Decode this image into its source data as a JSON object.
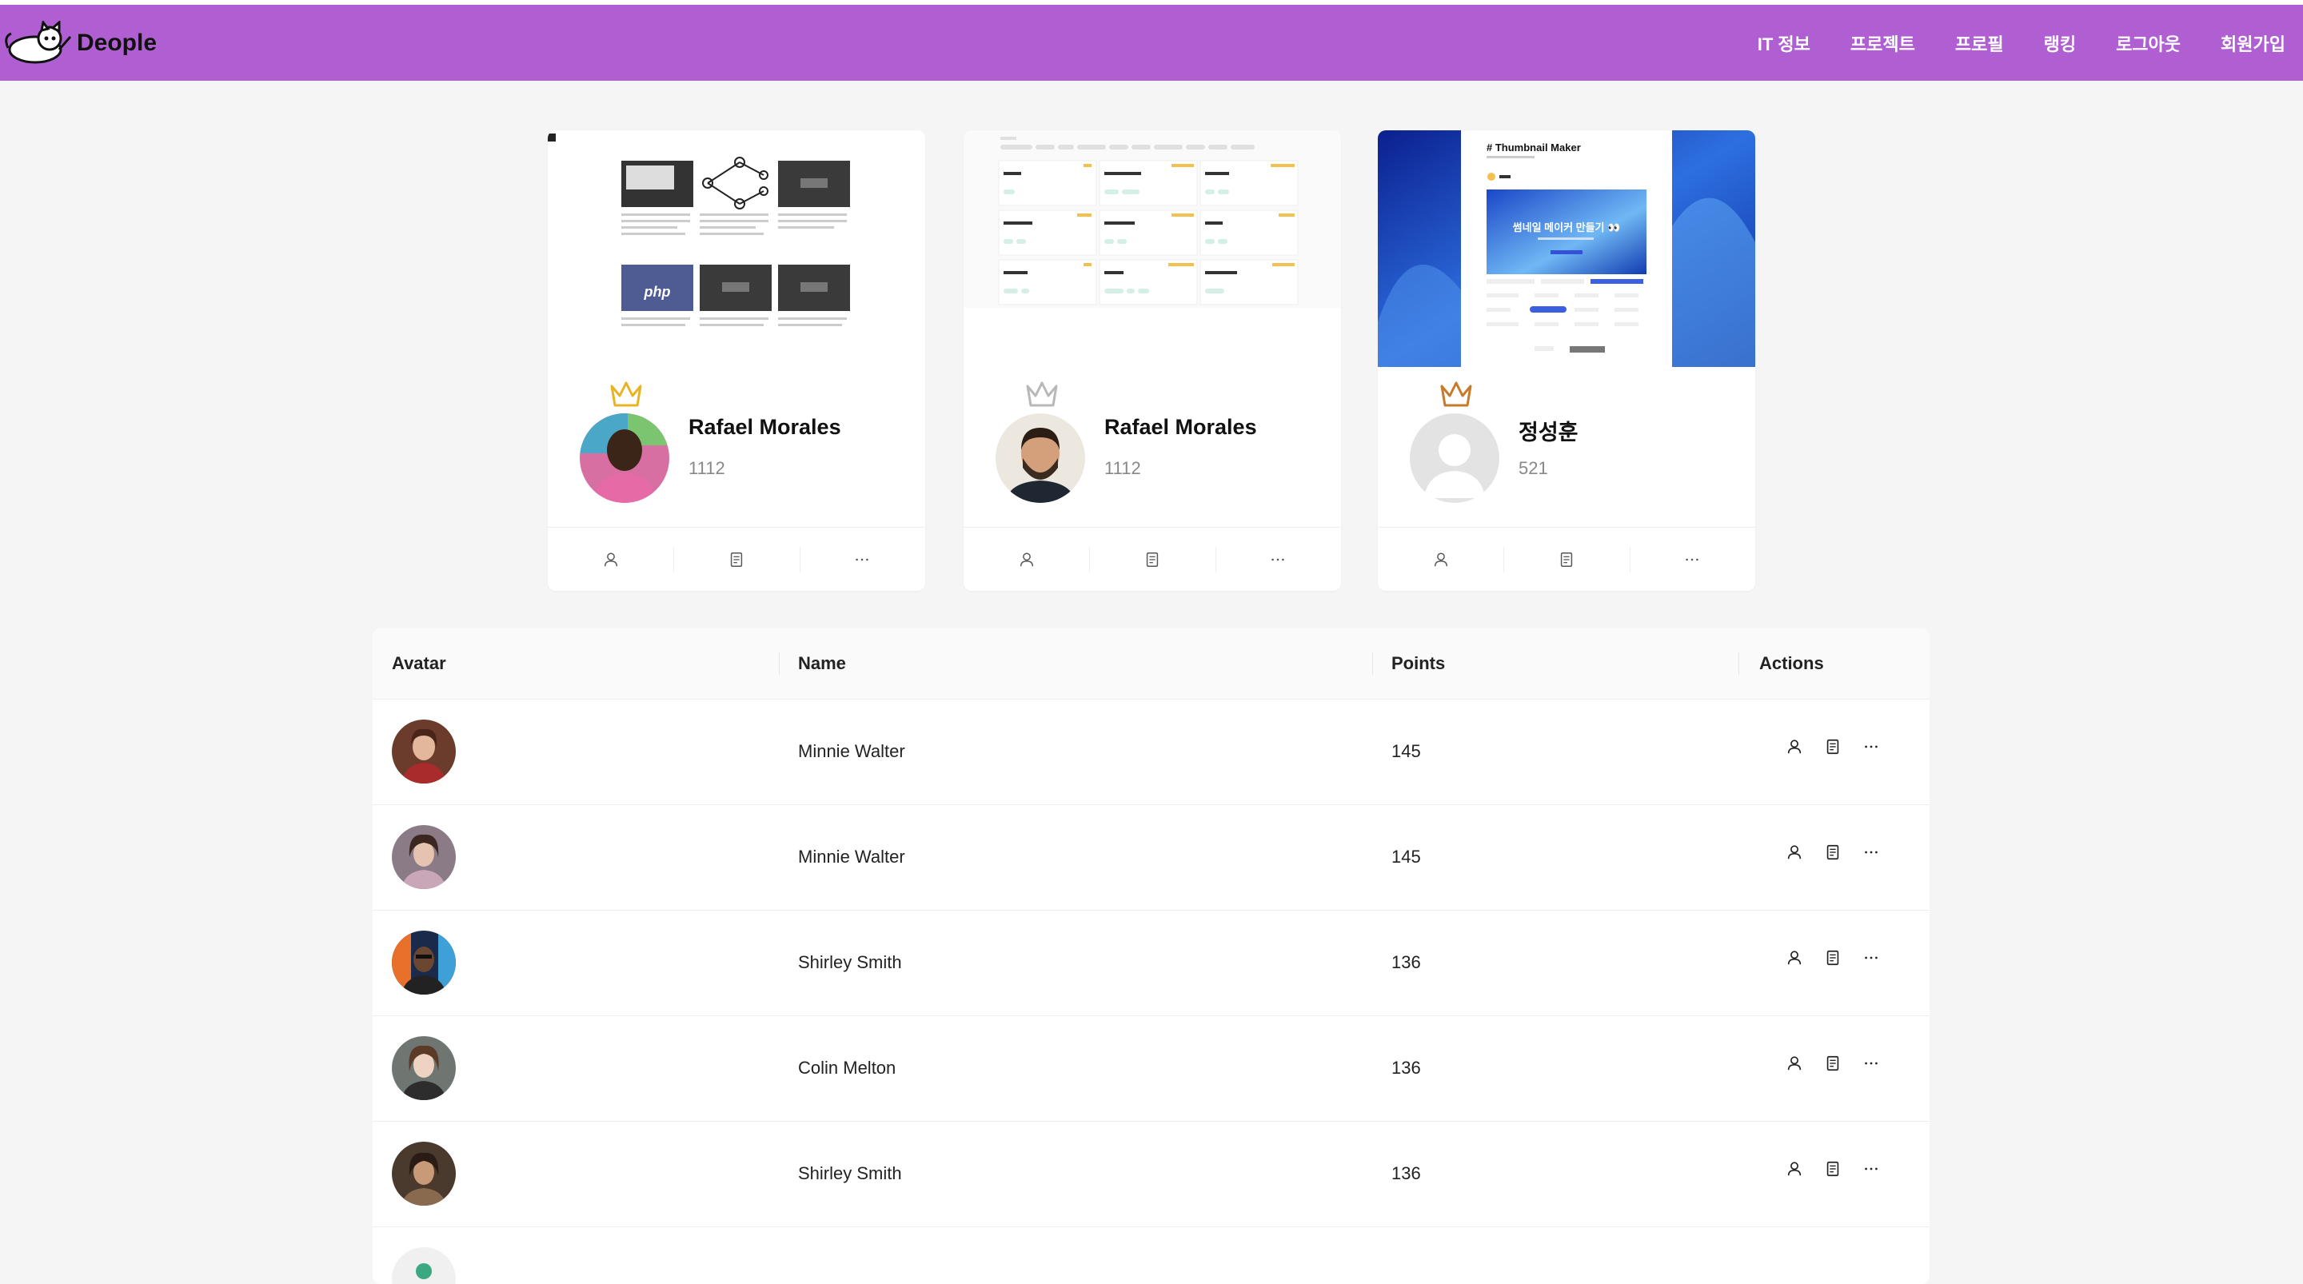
{
  "header": {
    "logo_text": "Deople",
    "nav": [
      "IT 정보",
      "프로젝트",
      "프로필",
      "랭킹",
      "로그아웃",
      "회원가입"
    ],
    "bg_color": "#b05fd2"
  },
  "top_cards": [
    {
      "name": "Rafael Morales",
      "points": "1112",
      "crown": "gold",
      "cover": "blog-grid"
    },
    {
      "name": "Rafael Morales",
      "points": "1112",
      "crown": "silver",
      "cover": "problem-list"
    },
    {
      "name": "정성훈",
      "points": "521",
      "crown": "bronze",
      "cover": "thumbnail-maker"
    }
  ],
  "covers": {
    "card1": {
      "php_label": "php"
    },
    "card3": {
      "title": "# Thumbnail Maker",
      "banner": "썸네일 메이커 만들기 👀"
    }
  },
  "table": {
    "headers": {
      "avatar": "Avatar",
      "name": "Name",
      "points": "Points",
      "actions": "Actions"
    },
    "rows": [
      {
        "name": "Minnie Walter",
        "points": "145"
      },
      {
        "name": "Minnie Walter",
        "points": "145"
      },
      {
        "name": "Shirley Smith",
        "points": "136"
      },
      {
        "name": "Colin Melton",
        "points": "136"
      },
      {
        "name": "Shirley Smith",
        "points": "136"
      }
    ]
  },
  "icons": {
    "action_icons": [
      "user-icon",
      "document-icon",
      "more-icon"
    ]
  }
}
